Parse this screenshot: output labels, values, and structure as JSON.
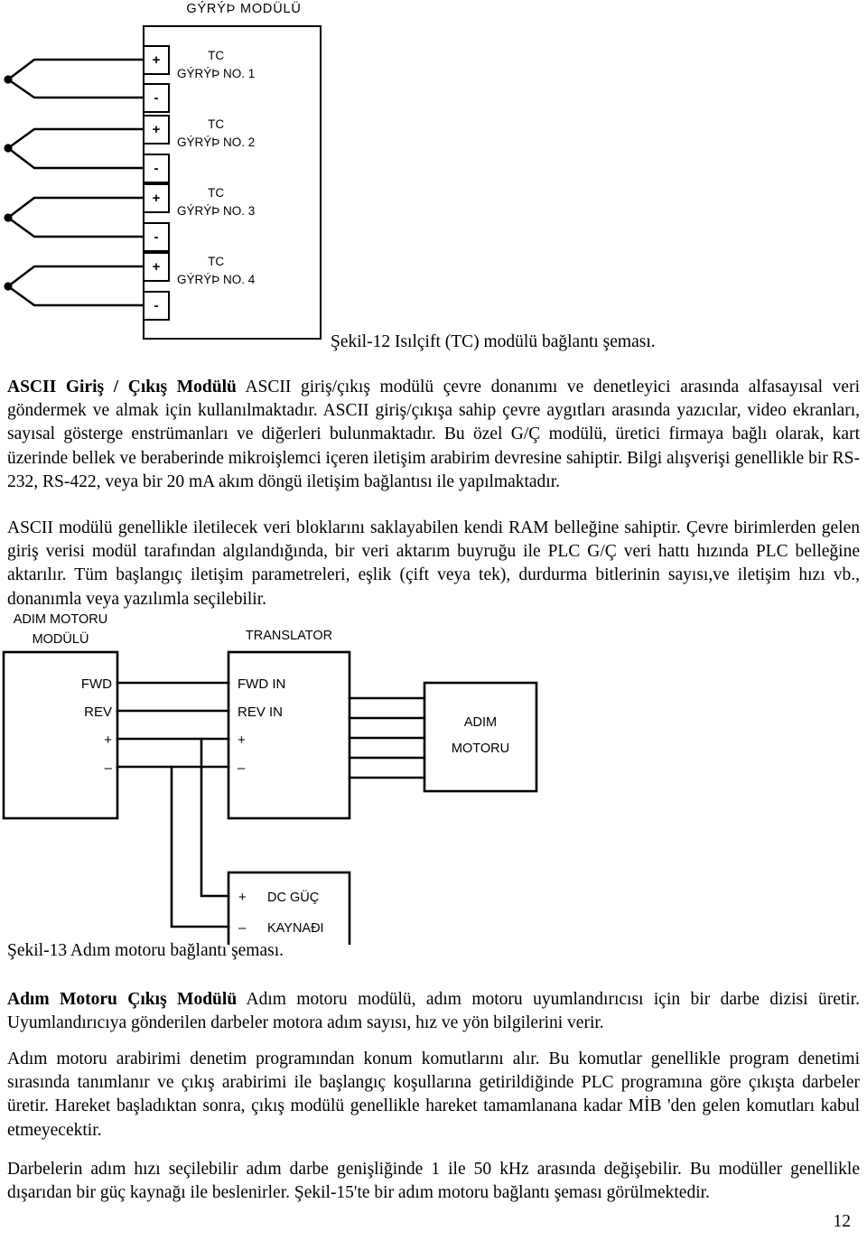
{
  "figure12": {
    "title": "GÝRÝÞ  MODÜLÜ",
    "channels": [
      {
        "tc": "TC",
        "name": "GÝRÝÞ NO. 1",
        "plus": "+",
        "minus": "-"
      },
      {
        "tc": "TC",
        "name": "GÝRÝÞ NO. 2",
        "plus": "+",
        "minus": "-"
      },
      {
        "tc": "TC",
        "name": "GÝRÝÞ NO. 3",
        "plus": "+",
        "minus": "-"
      },
      {
        "tc": "TC",
        "name": "GÝRÝÞ NO. 4",
        "plus": "+",
        "minus": "-"
      }
    ],
    "caption": "Şekil-12 Isılçift (TC) modülü bağlantı şeması."
  },
  "paragraph1": {
    "heading": "ASCII Giriş / Çıkış Modülü",
    "text": " ASCII giriş/çıkış modülü çevre donanımı ve denetleyici arasında alfasayısal veri göndermek ve almak için kullanılmaktadır. ASCII giriş/çıkışa sahip çevre aygıtları arasında yazıcılar, video ekranları, sayısal gösterge enstrümanları ve diğerleri bulunmaktadır. Bu özel G/Ç modülü, üretici firmaya bağlı olarak, kart üzerinde bellek ve beraberinde mikroişlemci içeren iletişim arabirim devresine sahiptir. Bilgi alışverişi genellikle bir RS-232, RS-422, veya bir 20 mA akım döngü iletişim bağlantısı ile yapılmaktadır."
  },
  "paragraph2": {
    "text": "ASCII modülü genellikle iletilecek veri bloklarını saklayabilen kendi RAM belleğine sahiptir. Çevre birimlerden gelen giriş verisi modül tarafından algılandığında, bir veri aktarım buyruğu ile PLC G/Ç veri hattı hızında PLC belleğine aktarılır. Tüm başlangıç iletişim parametreleri, eşlik (çift veya tek), durdurma bitlerinin sayısı,ve iletişim hızı vb., donanımla veya yazılımla seçilebilir."
  },
  "figure13": {
    "module_title_line1": "ADIM MOTORU",
    "module_title_line2": "MODÜLÜ",
    "translator_title": "TRANSLATOR",
    "module_terminals": [
      "FWD",
      "REV",
      "+",
      "–"
    ],
    "translator_terminals": [
      "FWD IN",
      "REV IN",
      "+",
      "–"
    ],
    "motor_label_line1": "ADIM",
    "motor_label_line2": "MOTORU",
    "psu_plus": "+",
    "psu_minus": "–",
    "psu_label_line1": "DC GÜÇ",
    "psu_label_line2": "KAYNAÐI",
    "caption": "Şekil-13 Adım motoru bağlantı şeması."
  },
  "paragraph3": {
    "heading": "Adım Motoru Çıkış Modülü",
    "text": " Adım motoru modülü, adım motoru uyumlandırıcısı için bir darbe dizisi üretir. Uyumlandırıcıya gönderilen darbeler motora adım sayısı, hız ve yön bilgilerini verir."
  },
  "paragraph4": {
    "text": "Adım motoru arabirimi denetim programından konum komutlarını alır. Bu komutlar genellikle program denetimi sırasında tanımlanır ve çıkış arabirimi ile başlangıç koşullarına getirildiğinde PLC programına göre çıkışta darbeler üretir. Hareket başladıktan sonra, çıkış modülü genellikle hareket tamamlanana kadar MİB 'den gelen komutları kabul etmeyecektir."
  },
  "paragraph5": {
    "text": "Darbelerin adım hızı seçilebilir adım darbe genişliğinde 1 ile 50 kHz arasında değişebilir. Bu modüller genellikle dışarıdan bir güç kaynağı ile beslenirler. Şekil-15'te bir adım motoru bağlantı şeması görülmektedir."
  },
  "page_number": "12"
}
